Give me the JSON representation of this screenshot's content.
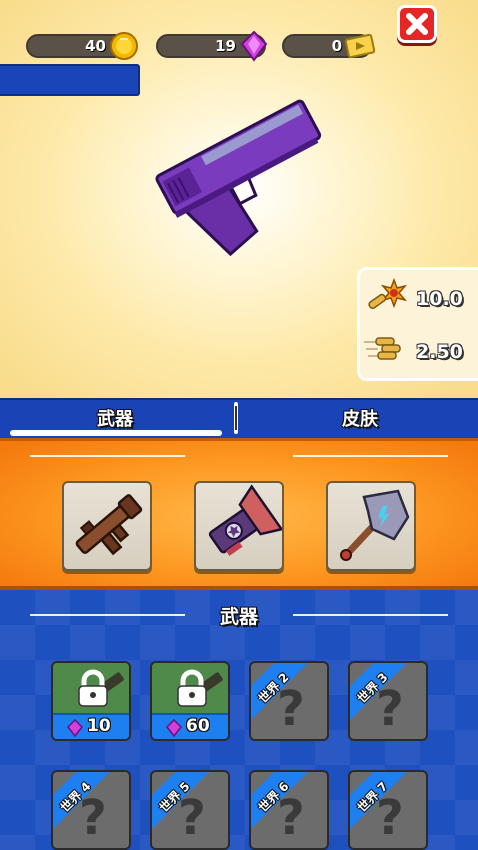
{
  "currencies": {
    "coins": "40",
    "gems": "19",
    "tickets": "0"
  },
  "stats": {
    "damage": "10.0",
    "fire_rate": "2.50"
  },
  "tabs": [
    {
      "label": "武器",
      "active": true
    },
    {
      "label": "皮肤",
      "active": false
    }
  ],
  "equipped_slots": [
    "rocket-launcher-icon",
    "star-cannon-icon",
    "hammer-icon"
  ],
  "section": {
    "title": "武器"
  },
  "weapon_cards": [
    {
      "state": "locked",
      "price": "10"
    },
    {
      "state": "locked",
      "price": "60"
    },
    {
      "state": "world",
      "label": "世界 2"
    },
    {
      "state": "world",
      "label": "世界 3"
    },
    {
      "state": "world",
      "label": "世界 4"
    },
    {
      "state": "world",
      "label": "世界 5"
    },
    {
      "state": "world",
      "label": "世界 6"
    },
    {
      "state": "world",
      "label": "世界 7"
    }
  ],
  "colors": {
    "accent_blue": "#1a44b6",
    "panel_orange": "#fd9820",
    "gun_purple": "#6a2ea6",
    "close_red": "#e42624"
  }
}
